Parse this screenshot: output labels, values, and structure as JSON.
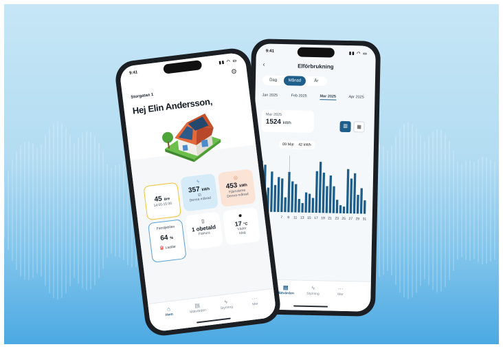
{
  "colors": {
    "accent": "#1e5e8a",
    "bar": "#1e5e8a",
    "highlight": "#f1c232",
    "backdrop": "#b3dcf2"
  },
  "right_phone": {
    "status": {
      "time": "9:41"
    },
    "header": {
      "title": "Elförbrukning",
      "back_icon": "chevron-left-icon"
    },
    "segments": [
      {
        "label": "Dag",
        "active": false
      },
      {
        "label": "Månad",
        "active": true
      },
      {
        "label": "År",
        "active": false
      }
    ],
    "months": [
      {
        "label": "Jan 2025",
        "selected": false
      },
      {
        "label": "Feb 2025",
        "selected": false
      },
      {
        "label": "Mar 2025",
        "selected": true
      },
      {
        "label": "Apr 2025",
        "selected": false
      }
    ],
    "summary": {
      "period": "Mar 2025",
      "value": "1524",
      "unit": "kWh"
    },
    "view_toggle": {
      "bar_icon": "bar-chart-icon",
      "table_icon": "table-icon"
    },
    "tooltip": {
      "date": "09 Mar",
      "value": "42 kWh"
    },
    "y_unit_fragment": "h",
    "footer_fragment": "rukning",
    "tabs": [
      {
        "label": "Mätvärden",
        "icon": "meter-icon",
        "active": true
      },
      {
        "label": "Styrning",
        "icon": "bolt-icon",
        "active": false
      },
      {
        "label": "Mer",
        "icon": "more-icon",
        "active": false
      }
    ]
  },
  "left_phone": {
    "status": {
      "time": "9:41"
    },
    "address": "Storgatan 1",
    "greeting": "Hej Elin Andersson,",
    "tiles": {
      "price": {
        "value": "45",
        "unit": "öre",
        "sub": "14:00-15:00"
      },
      "el": {
        "icon": "bolt-icon",
        "value": "357",
        "unit": "kWh",
        "label": "El",
        "sub": "Denna månad"
      },
      "heat": {
        "icon": "heat-icon",
        "value": "453",
        "unit": "kWh",
        "label": "Fjärrvärme",
        "sub": "Denna månad"
      },
      "car": {
        "title": "Familjebilen",
        "value": "64",
        "unit": "%",
        "sub": "Laddar",
        "icon": "car-charging-icon"
      },
      "invoice": {
        "icon": "invoice-icon",
        "value": "1 obetald",
        "sub": "Faktura"
      },
      "weather": {
        "icon": "sun-icon",
        "value": "17",
        "unit": "°C",
        "label": "Väder",
        "sub": "Idag"
      }
    },
    "tabs": [
      {
        "label": "Hem",
        "icon": "home-icon",
        "active": true
      },
      {
        "label": "Mätvärden",
        "icon": "meter-icon",
        "active": false
      },
      {
        "label": "Styrning",
        "icon": "bolt-icon",
        "active": false
      },
      {
        "label": "Mer",
        "icon": "more-icon",
        "active": false
      }
    ]
  },
  "chart_data": {
    "type": "bar",
    "title": "",
    "x": [
      1,
      2,
      3,
      4,
      5,
      6,
      7,
      8,
      9,
      10,
      11,
      12,
      13,
      14,
      15,
      16,
      17,
      18,
      19,
      20,
      21,
      22,
      23,
      24,
      25,
      26,
      27,
      28,
      29,
      30,
      31
    ],
    "x_tick_labels": [
      "7",
      "9",
      "11",
      "13",
      "15",
      "17",
      "19",
      "21",
      "23",
      "25",
      "27",
      "29",
      "31"
    ],
    "values": [
      76,
      70,
      36,
      60,
      40,
      52,
      50,
      22,
      60,
      46,
      42,
      20,
      14,
      30,
      28,
      22,
      62,
      76,
      60,
      40,
      56,
      40,
      20,
      12,
      10,
      66,
      52,
      60,
      28,
      38,
      20
    ],
    "ylim": [
      0,
      80
    ],
    "highlight_index": 8,
    "grid": false
  }
}
